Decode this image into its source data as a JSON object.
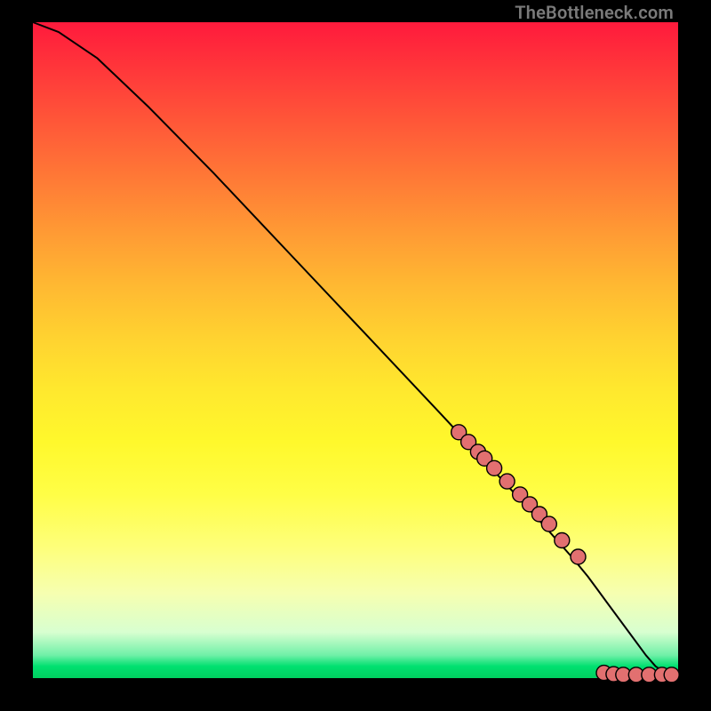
{
  "watermark": "TheBottleneck.com",
  "chart_data": {
    "type": "line",
    "x": [
      0.0,
      0.04,
      0.1,
      0.18,
      0.28,
      0.4,
      0.52,
      0.63,
      0.72,
      0.79,
      0.835,
      0.86,
      0.875,
      0.89,
      0.905,
      0.92,
      0.935,
      0.95,
      0.965,
      0.98,
      1.0
    ],
    "values": [
      1.0,
      0.985,
      0.945,
      0.87,
      0.77,
      0.645,
      0.52,
      0.405,
      0.31,
      0.235,
      0.185,
      0.155,
      0.135,
      0.115,
      0.095,
      0.075,
      0.055,
      0.035,
      0.018,
      0.008,
      0.004
    ],
    "xlim": [
      0,
      1
    ],
    "ylim": [
      0,
      1
    ],
    "markers_x": [
      0.66,
      0.675,
      0.69,
      0.7,
      0.715,
      0.735,
      0.755,
      0.77,
      0.785,
      0.8,
      0.82,
      0.845,
      0.885,
      0.9,
      0.915,
      0.935,
      0.955,
      0.975,
      0.99
    ],
    "markers_y": [
      0.375,
      0.36,
      0.345,
      0.335,
      0.32,
      0.3,
      0.28,
      0.265,
      0.25,
      0.235,
      0.21,
      0.185,
      0.008,
      0.006,
      0.005,
      0.005,
      0.005,
      0.005,
      0.005
    ],
    "title": "",
    "xlabel": "",
    "ylabel": ""
  },
  "colors": {
    "marker_fill": "#e27070",
    "marker_stroke": "#000000",
    "curve": "#000000"
  }
}
